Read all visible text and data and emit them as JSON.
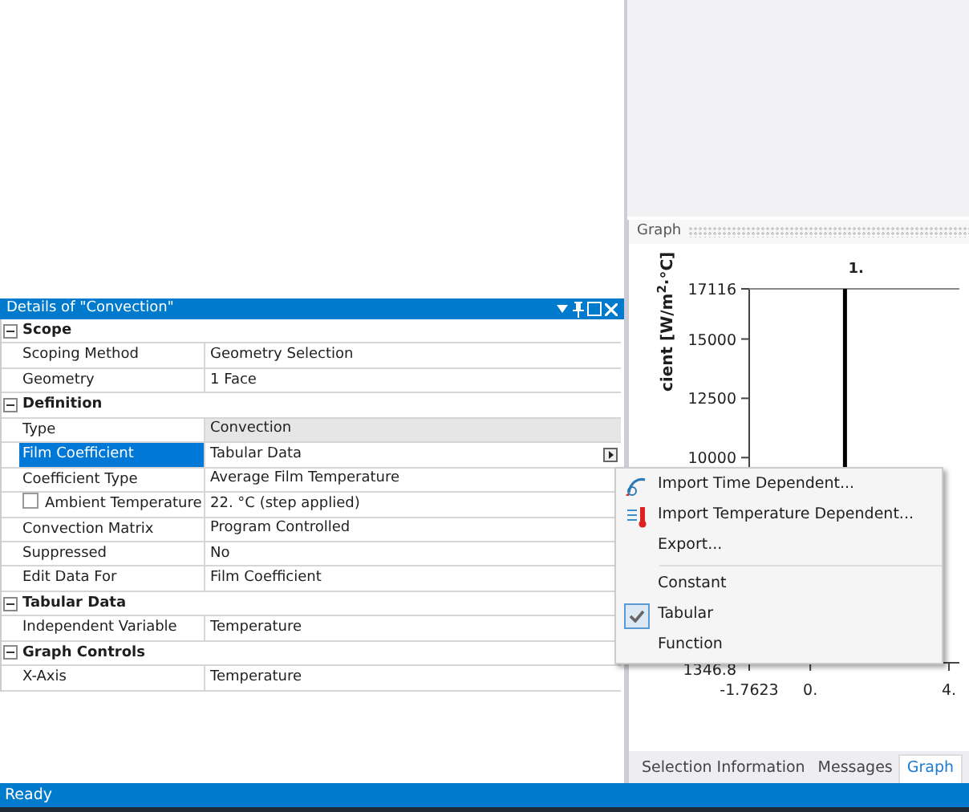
{
  "details": {
    "title": "Details of \"Convection\"",
    "groups": [
      {
        "label": "Scope",
        "expanded": true,
        "rows": [
          {
            "label": "Scoping Method",
            "value": "Geometry Selection",
            "selected": false,
            "readonly": false
          },
          {
            "label": "Geometry",
            "value": "1 Face",
            "selected": false,
            "readonly": false
          }
        ]
      },
      {
        "label": "Definition",
        "expanded": true,
        "rows": [
          {
            "label": "Type",
            "value": "Convection",
            "selected": false,
            "readonly": true
          },
          {
            "label": "Film Coefficient",
            "value": "Tabular Data",
            "selected": true,
            "readonly": false,
            "has_flyout": true
          },
          {
            "label": "Coefficient Type",
            "value": "Average Film Temperature",
            "selected": false,
            "readonly": false
          },
          {
            "label": "Ambient Temperature",
            "value": "22. °C  (step applied)",
            "selected": false,
            "readonly": false,
            "checkbox": true,
            "checked": false
          },
          {
            "label": "Convection Matrix",
            "value": "Program Controlled",
            "selected": false,
            "readonly": false
          },
          {
            "label": "Suppressed",
            "value": "No",
            "selected": false,
            "readonly": false
          },
          {
            "label": "Edit Data For",
            "value": "Film Coefficient",
            "selected": false,
            "readonly": false
          }
        ]
      },
      {
        "label": "Tabular Data",
        "expanded": true,
        "rows": [
          {
            "label": "Independent Variable",
            "value": "Temperature",
            "selected": false,
            "readonly": false
          }
        ]
      },
      {
        "label": "Graph Controls",
        "expanded": true,
        "rows": [
          {
            "label": "X-Axis",
            "value": "Temperature",
            "selected": false,
            "readonly": false
          }
        ]
      }
    ]
  },
  "graph": {
    "title": "Graph",
    "chart_data": {
      "type": "line",
      "ylabel": "cient [W/m$^{2}$·°C]",
      "xlim": [
        -1.7623,
        4.3
      ],
      "ylim": [
        1346.8,
        17116
      ],
      "xticks": [
        {
          "value": -1.7623,
          "label": "-1.7623"
        },
        {
          "value": 0,
          "label": "0."
        },
        {
          "value": 4,
          "label": "4."
        }
      ],
      "yticks": [
        {
          "value": 1346.8,
          "label": "1346.8"
        },
        {
          "value": 10000,
          "label": "10000"
        },
        {
          "value": 12500,
          "label": "12500"
        },
        {
          "value": 15000,
          "label": "15000"
        },
        {
          "value": 17116,
          "label": "17116"
        }
      ],
      "annotations": [
        {
          "x": 1,
          "y": 17116,
          "text": "1."
        }
      ],
      "series": [
        {
          "color": "#000000",
          "x": [
            1,
            1
          ],
          "values": [
            9600,
            17116
          ]
        }
      ]
    },
    "tabs": [
      {
        "label": "Selection Information",
        "selected": false
      },
      {
        "label": "Messages",
        "selected": false
      },
      {
        "label": "Graph",
        "selected": true
      }
    ]
  },
  "context_menu": [
    {
      "kind": "command",
      "label": "Import Time Dependent..."
    },
    {
      "kind": "command",
      "label": "Import Temperature Dependent..."
    },
    {
      "kind": "command",
      "label": "Export..."
    },
    {
      "kind": "separator"
    },
    {
      "kind": "option",
      "label": "Constant",
      "checked": false
    },
    {
      "kind": "option",
      "label": "Tabular",
      "checked": true
    },
    {
      "kind": "option",
      "label": "Function",
      "checked": false
    }
  ],
  "status_bar": {
    "text": "Ready"
  }
}
